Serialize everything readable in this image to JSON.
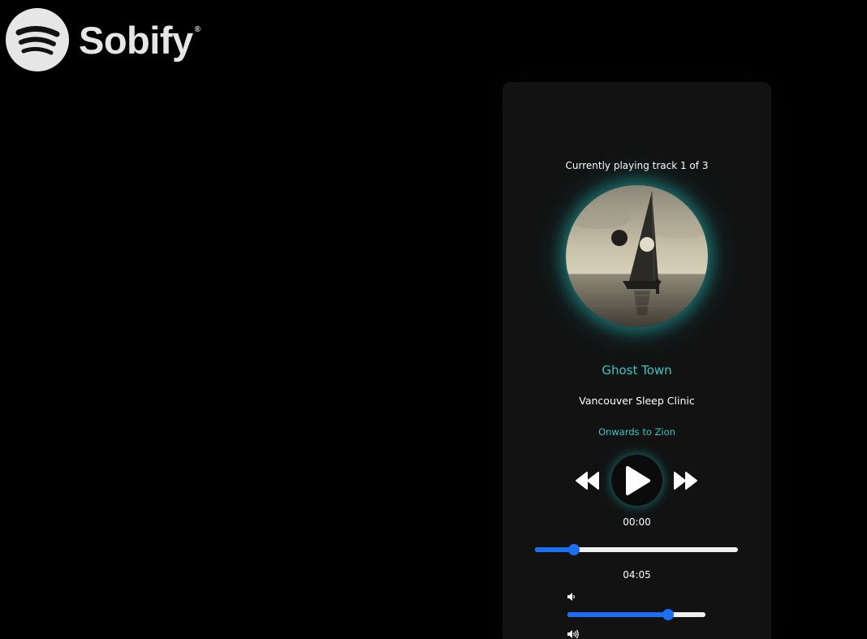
{
  "brand": {
    "name": "Sobify",
    "reg_mark": "®",
    "icon": "sobify-logo-icon"
  },
  "player": {
    "status_text": "Currently playing track 1 of 3",
    "track": {
      "title": "Ghost Town",
      "artist": "Vancouver Sleep Clinic",
      "album": "Onwards to Zion"
    },
    "controls": {
      "prev_icon": "rewind-icon",
      "play_icon": "play-icon",
      "next_icon": "fast-forward-icon"
    },
    "time_current": "00:00",
    "time_total": "04:05",
    "progress_fraction": 0.19,
    "volume_fraction": 0.73,
    "volume_low_icon": "volume-low-icon",
    "volume_high_icon": "volume-high-icon"
  },
  "colors": {
    "accent": "#38c6c0",
    "glow": "#25bebe",
    "slider": "#1c6ff0",
    "background": "#000000",
    "card": "#121212"
  }
}
